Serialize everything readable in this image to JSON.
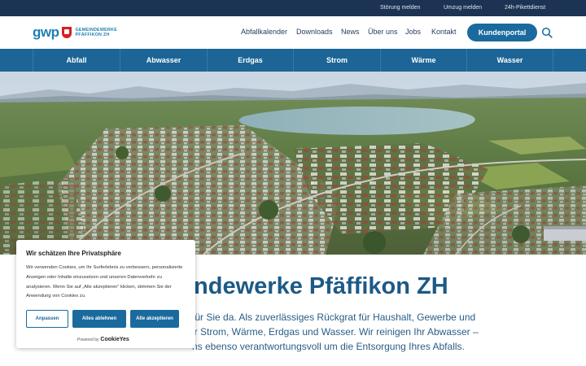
{
  "topbar": {
    "links": [
      {
        "label": "Störung melden"
      },
      {
        "label": "Umzug melden"
      },
      {
        "label": "24h-Pikettdienst"
      }
    ]
  },
  "header": {
    "logo": {
      "mark": "gwp",
      "line1": "GEMEINDEWERKE",
      "line2": "PFÄFFIKON ZH"
    },
    "nav": [
      {
        "label": "Abfallkalender"
      },
      {
        "label": "Downloads"
      },
      {
        "label": "News"
      },
      {
        "label": "Über uns"
      },
      {
        "label": "Jobs"
      },
      {
        "label": "Kontakt"
      }
    ],
    "portal_label": "Kundenportal",
    "search_icon": "search-icon"
  },
  "categories": [
    {
      "label": "Abfall"
    },
    {
      "label": "Abwasser"
    },
    {
      "label": "Erdgas"
    },
    {
      "label": "Strom"
    },
    {
      "label": "Wärme"
    },
    {
      "label": "Wasser"
    }
  ],
  "main": {
    "title": "indewerke Pfäffikon ZH",
    "intro_lines": [
      "für Sie da. Als zuverlässiges Rückgrat für Haushalt, Gewerbe und",
      "ir Strom, Wärme, Erdgas und Wasser. Wir reinigen Ihr Abwasser –",
      "ns ebenso verantwortungsvoll um die Entsorgung Ihres Abfalls."
    ]
  },
  "cookie": {
    "title": "Wir schätzen Ihre Privatsphäre",
    "text": "Wir verwenden Cookies, um Ihr Surferlebnis zu verbessern, personalisierte Anzeigen oder Inhalte einzusetzen und unseren Datenverkehr zu analysieren. Wenn Sie auf „Alle akzeptieren“ klicken, stimmen Sie der Anwendung von Cookies zu.",
    "btn_customize": "Anpassen",
    "btn_reject": "Alles ablehnen",
    "btn_accept": "Alle akzeptieren",
    "powered_by": "Powered by",
    "powered_brand": "CookieYes"
  },
  "colors": {
    "topbar": "#1c3354",
    "brand_blue": "#1a6a9e",
    "category_bar": "#1c6596",
    "title": "#1c5a86"
  }
}
